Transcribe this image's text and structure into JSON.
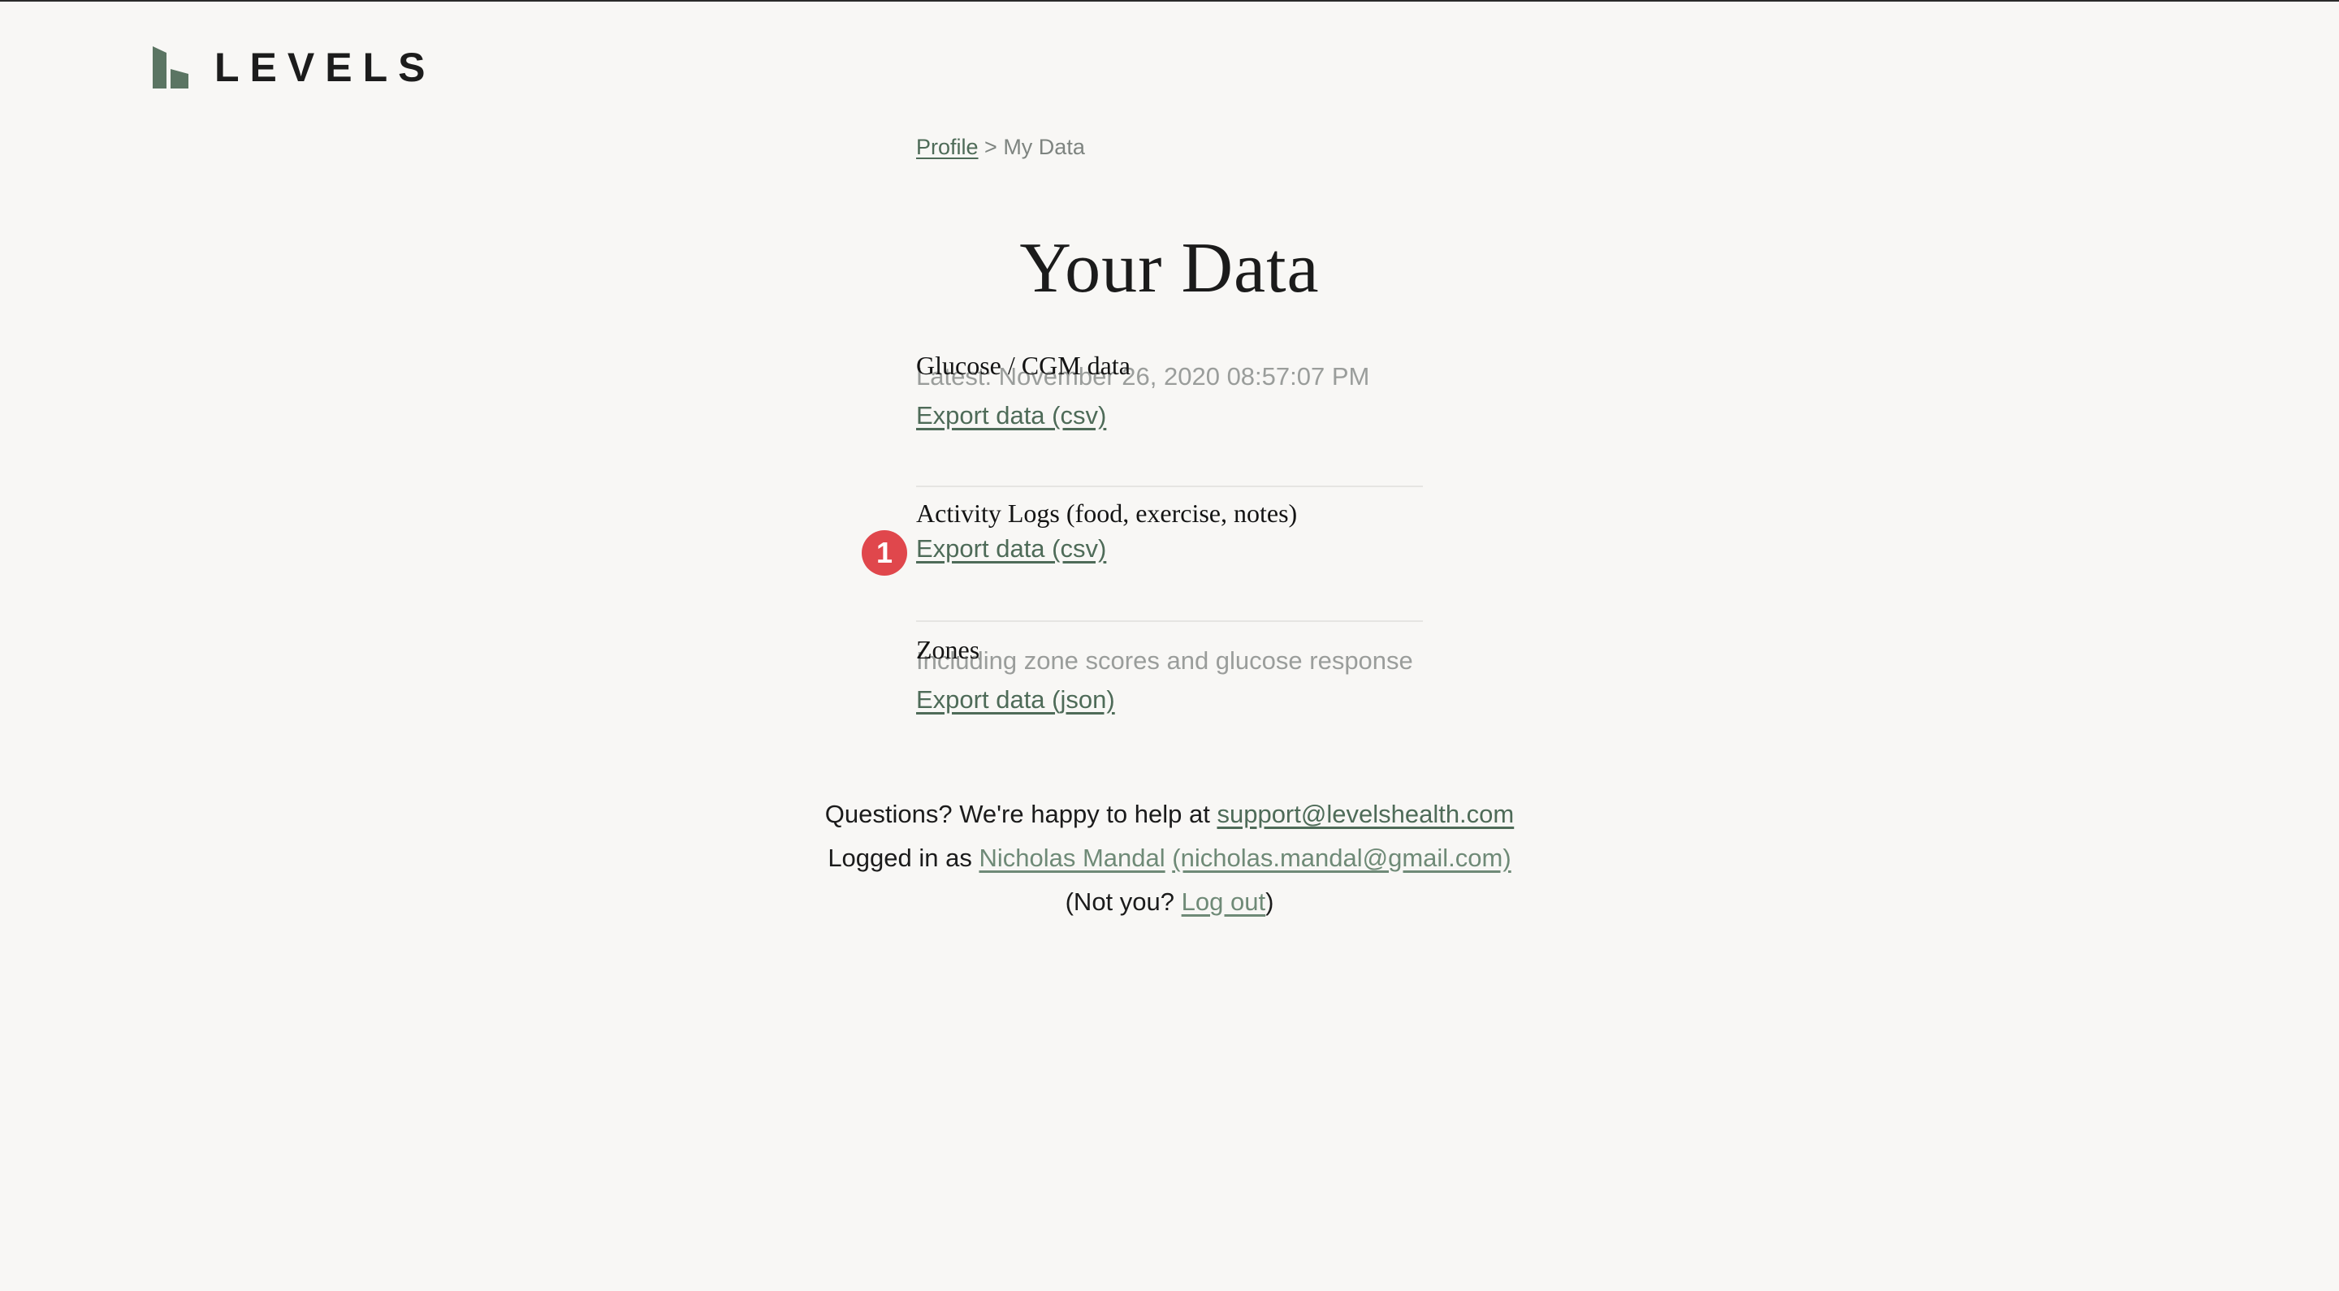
{
  "brand": {
    "name": "LEVELS",
    "accent": "#5b7563"
  },
  "breadcrumb": {
    "parent": "Profile",
    "separator": " > ",
    "current": "My Data"
  },
  "page_title": "Your Data",
  "sections": [
    {
      "title": "Glucose / CGM data",
      "subtitle": "Latest: November 26, 2020 08:57:07 PM",
      "link": "Export data (csv)"
    },
    {
      "title": "Activity Logs (food, exercise, notes)",
      "subtitle": "",
      "link": "Export data (csv)"
    },
    {
      "title": "Zones",
      "subtitle": "Including zone scores and glucose response",
      "link": "Export data (json)"
    }
  ],
  "annotation": {
    "number": "1",
    "color": "#e0474c"
  },
  "footer": {
    "help_text": "Questions? We're happy to help at ",
    "support_email": "support@levelshealth.com",
    "logged_in_prefix": "Logged in as ",
    "user_name": "Nicholas Mandal",
    "user_email": "(nicholas.mandal@gmail.com)",
    "not_you_prefix": "(Not you? ",
    "logout_label": "Log out",
    "not_you_suffix": ")"
  }
}
